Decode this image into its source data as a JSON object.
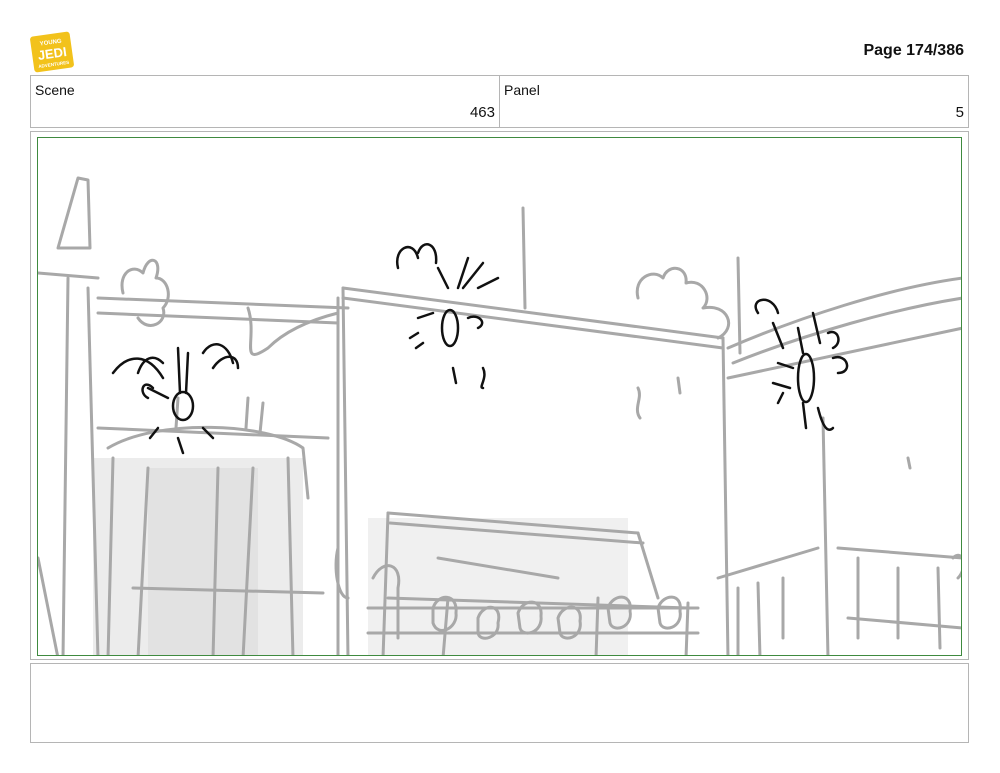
{
  "header": {
    "logo_text_top": "YOUNG",
    "logo_text_mid": "JEDI",
    "logo_text_bottom": "ADVENTURES",
    "page_label": "Page 174/386"
  },
  "info": {
    "scene_label": "Scene",
    "scene_value": "463",
    "panel_label": "Panel",
    "panel_value": "5"
  },
  "colors": {
    "frame_border": "#3f8a3f",
    "sketch_gray": "#a8a8a8",
    "sketch_black": "#111111",
    "logo_yellow": "#f2c21b"
  },
  "notes": {
    "text": ""
  }
}
